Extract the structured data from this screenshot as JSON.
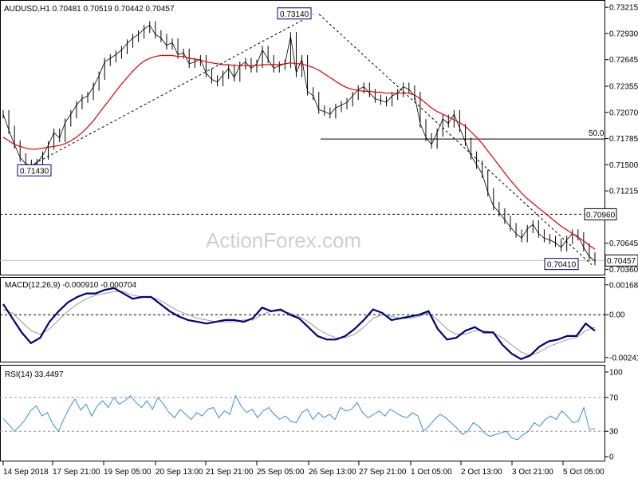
{
  "header": {
    "title": "AUDUSD,H1",
    "ohlc": "0.70481 0.70519 0.70442 0.70457"
  },
  "watermark": "ActionForex.com",
  "colors": {
    "price": "#000000",
    "ma": "#e00000",
    "macd": "#00007a",
    "signal": "#9a9a9a",
    "rsi": "#3b8fd8",
    "fib": "#000000",
    "box_border": "#00007a",
    "grid": "#888888"
  },
  "chart_data": [
    {
      "type": "line",
      "panel": "price",
      "title": "AUDUSD,H1",
      "y_ticks": [
        "0.73215",
        "0.72930",
        "0.72645",
        "0.72355",
        "0.72070",
        "0.71785",
        "0.71500",
        "0.71215",
        "0.70645",
        "0.70360"
      ],
      "ylim": [
        0.7032,
        0.7326
      ],
      "fib_label": "50.0",
      "fib_level": 0.7178,
      "support_level": 0.7096,
      "support_label": "0.70960",
      "current_price": 0.70457,
      "current_label": "0.70457",
      "annotations": [
        {
          "label": "0.73140",
          "value": 0.7314
        },
        {
          "label": "0.71430",
          "value": 0.7143
        },
        {
          "label": "0.70410",
          "value": 0.7041
        }
      ],
      "series": [
        {
          "name": "price",
          "values": [
            0.7205,
            0.7188,
            0.7172,
            0.7158,
            0.7151,
            0.7149,
            0.7152,
            0.716,
            0.7171,
            0.7185,
            0.7179,
            0.7196,
            0.7205,
            0.7215,
            0.7222,
            0.7225,
            0.7235,
            0.7247,
            0.7262,
            0.7266,
            0.727,
            0.7275,
            0.7282,
            0.7288,
            0.7292,
            0.7298,
            0.7302,
            0.7292,
            0.7288,
            0.728,
            0.7283,
            0.727,
            0.7272,
            0.726,
            0.7262,
            0.7265,
            0.725,
            0.7243,
            0.724,
            0.7248,
            0.7255,
            0.7245,
            0.7258,
            0.7262,
            0.7255,
            0.726,
            0.7275,
            0.7265,
            0.7255,
            0.7258,
            0.726,
            0.729,
            0.725,
            0.7265,
            0.723,
            0.7225,
            0.721,
            0.7208,
            0.7205,
            0.7212,
            0.7215,
            0.7218,
            0.7225,
            0.7232,
            0.7235,
            0.7228,
            0.7222,
            0.722,
            0.7218,
            0.7225,
            0.7228,
            0.7235,
            0.7232,
            0.7225,
            0.7195,
            0.718,
            0.7172,
            0.7185,
            0.72,
            0.7195,
            0.7205,
            0.719,
            0.7175,
            0.716,
            0.715,
            0.714,
            0.712,
            0.7105,
            0.7098,
            0.709,
            0.7082,
            0.7075,
            0.707,
            0.708,
            0.7085,
            0.7075,
            0.707,
            0.7068,
            0.7065,
            0.706,
            0.7068,
            0.7075,
            0.7072,
            0.706,
            0.705,
            0.7045
          ]
        },
        {
          "name": "ma",
          "values": [
            0.718,
            0.7176,
            0.7172,
            0.717,
            0.7168,
            0.7167,
            0.7167,
            0.7168,
            0.7169,
            0.717,
            0.7171,
            0.7173,
            0.7176,
            0.718,
            0.7185,
            0.7191,
            0.7198,
            0.7206,
            0.7214,
            0.7222,
            0.723,
            0.7238,
            0.7245,
            0.7252,
            0.7258,
            0.7263,
            0.7266,
            0.7268,
            0.7269,
            0.7269,
            0.7269,
            0.7268,
            0.7268,
            0.7266,
            0.7265,
            0.7264,
            0.7262,
            0.7261,
            0.726,
            0.7259,
            0.7259,
            0.7258,
            0.7258,
            0.7258,
            0.7258,
            0.7258,
            0.7259,
            0.7259,
            0.7259,
            0.7259,
            0.726,
            0.7261,
            0.726,
            0.726,
            0.7258,
            0.7256,
            0.7253,
            0.7249,
            0.7245,
            0.7241,
            0.7237,
            0.7234,
            0.7232,
            0.7231,
            0.723,
            0.723,
            0.7229,
            0.7229,
            0.7228,
            0.7228,
            0.7228,
            0.7228,
            0.7228,
            0.7226,
            0.7222,
            0.7217,
            0.7212,
            0.7208,
            0.7205,
            0.7202,
            0.7199,
            0.7196,
            0.7192,
            0.7186,
            0.718,
            0.7173,
            0.7165,
            0.7157,
            0.7149,
            0.7141,
            0.7133,
            0.7126,
            0.7119,
            0.7113,
            0.7108,
            0.7103,
            0.7098,
            0.7093,
            0.7088,
            0.7083,
            0.7079,
            0.7075,
            0.7071,
            0.7067,
            0.7062,
            0.7058
          ]
        }
      ]
    },
    {
      "type": "line",
      "panel": "macd",
      "title": "MACD(12,26,9) -0.000910 -0.000704",
      "y_ticks": [
        "0.001685",
        "0.00",
        "-0.00241"
      ],
      "ylim": [
        -0.0026,
        0.0019
      ],
      "series": [
        {
          "name": "macd",
          "values": [
            0.0006,
            -0.0002,
            -0.001,
            -0.0016,
            -0.0013,
            -0.0004,
            0.0002,
            0.0007,
            0.001,
            0.0012,
            0.0012,
            0.0014,
            0.0015,
            0.0012,
            0.0009,
            0.001,
            0.001,
            0.0006,
            0.0002,
            -0.0001,
            -0.0003,
            -0.0004,
            -0.0005,
            -0.0004,
            -0.0003,
            -0.0003,
            -0.0004,
            -0.0002,
            0.0004,
            0.0002,
            0.0003,
            0.0,
            -0.0002,
            -0.0007,
            -0.0012,
            -0.0014,
            -0.0014,
            -0.0012,
            -0.0008,
            -0.0003,
            0.0003,
            0.0001,
            -0.0003,
            -0.0002,
            -0.0001,
            0.0,
            0.0002,
            -0.0008,
            -0.0014,
            -0.0013,
            -0.0009,
            -0.0007,
            -0.001,
            -0.001,
            -0.0017,
            -0.0022,
            -0.0025,
            -0.0023,
            -0.0018,
            -0.0015,
            -0.0014,
            -0.0012,
            -0.0012,
            -0.0005,
            -0.0009
          ]
        },
        {
          "name": "signal",
          "values": [
            0.0003,
            0.0001,
            -0.0004,
            -0.0009,
            -0.0011,
            -0.0008,
            -0.0003,
            0.0002,
            0.0006,
            0.0009,
            0.0011,
            0.0012,
            0.0013,
            0.0013,
            0.0011,
            0.001,
            0.001,
            0.0008,
            0.0005,
            0.0002,
            -0.0,
            -0.0002,
            -0.0003,
            -0.0004,
            -0.0004,
            -0.0004,
            -0.0003,
            -0.0003,
            0.0,
            0.0002,
            0.0002,
            0.0001,
            -0.0001,
            -0.0004,
            -0.0008,
            -0.0011,
            -0.0013,
            -0.0013,
            -0.0011,
            -0.0007,
            -0.0002,
            0.0,
            -0.0001,
            -0.0002,
            -0.0002,
            -0.0001,
            0.0001,
            -0.0003,
            -0.0008,
            -0.0011,
            -0.0011,
            -0.0009,
            -0.0009,
            -0.001,
            -0.0013,
            -0.0017,
            -0.0021,
            -0.0023,
            -0.0021,
            -0.0018,
            -0.0016,
            -0.0014,
            -0.0013,
            -0.0009,
            -0.0007
          ]
        }
      ]
    },
    {
      "type": "line",
      "panel": "rsi",
      "title": "RSI(14) 33.4497",
      "y_ticks": [
        "100",
        "70",
        "30",
        "0"
      ],
      "ylim": [
        0,
        100
      ],
      "levels": [
        70,
        30
      ],
      "series": [
        {
          "name": "rsi",
          "values": [
            45,
            38,
            30,
            36,
            44,
            55,
            60,
            48,
            52,
            38,
            30,
            45,
            58,
            68,
            55,
            62,
            48,
            60,
            66,
            58,
            70,
            62,
            66,
            72,
            64,
            58,
            66,
            56,
            70,
            62,
            52,
            46,
            56,
            50,
            44,
            52,
            48,
            56,
            58,
            46,
            54,
            50,
            72,
            60,
            52,
            56,
            46,
            54,
            58,
            50,
            44,
            48,
            42,
            40,
            52,
            56,
            44,
            52,
            46,
            50,
            44,
            58,
            54,
            56,
            64,
            52,
            46,
            50,
            54,
            48,
            56,
            52,
            48,
            46,
            52,
            48,
            30,
            36,
            44,
            50,
            46,
            40,
            34,
            26,
            30,
            40,
            36,
            28,
            24,
            26,
            28,
            30,
            22,
            20,
            26,
            30,
            40,
            36,
            44,
            48,
            44,
            54,
            48,
            40,
            42,
            58,
            32,
            33
          ]
        }
      ]
    }
  ],
  "x_axis": {
    "labels": [
      "14 Sep 2018",
      "17 Sep 21:00",
      "19 Sep 05:00",
      "20 Sep 13:00",
      "21 Sep 21:00",
      "25 Sep 05:00",
      "26 Sep 13:00",
      "27 Sep 21:00",
      "1 Oct 05:00",
      "2 Oct 13:00",
      "3 Oct 21:00",
      "5 Oct 05:00"
    ]
  }
}
